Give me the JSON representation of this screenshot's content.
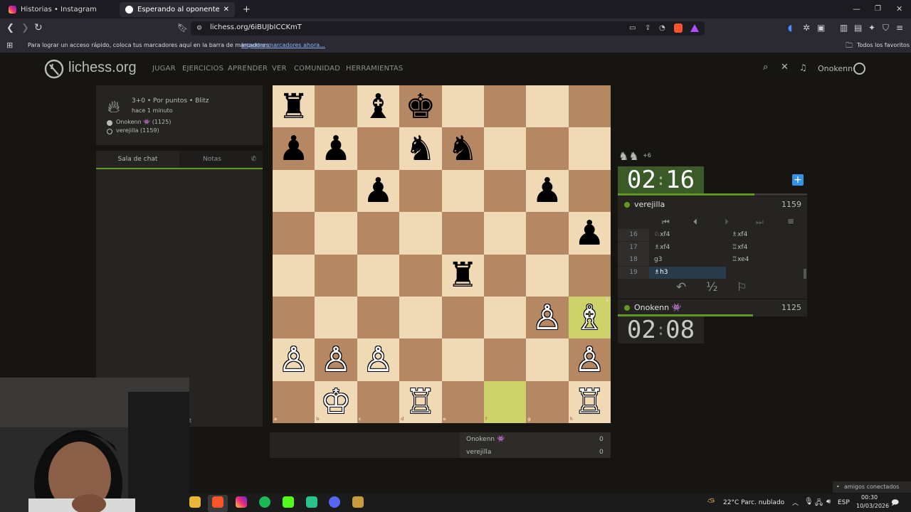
{
  "browser": {
    "tabs": [
      {
        "label": "Historias • Instagram",
        "active": false
      },
      {
        "label": "Esperando al oponente - Jug",
        "active": true
      }
    ],
    "new_tab": "+",
    "url": "lichess.org/6iBUJbICCKmT",
    "bookmarks_hint": "Para lograr un acceso rápido, coloca tus marcadores aquí en la barra de marcadores.",
    "bookmarks_import": "Importar marcadores ahora...",
    "all_favorites": "Todos los favoritos"
  },
  "site": {
    "logo": "lichess.org",
    "nav": [
      "JUGAR",
      "EJERCICIOS",
      "APRENDER",
      "VER",
      "COMUNIDAD",
      "HERRAMIENTAS"
    ],
    "username": "Onokenn"
  },
  "game_info": {
    "mode": "3+0 • Por puntos • Blitz",
    "time_ago": "hace 1 minuto",
    "white": "Onokenn 👾 (1125)",
    "black": "verejilla (1159)"
  },
  "chat": {
    "tab_chat": "Sala de chat",
    "tab_notes": "Notas",
    "partial_text": "t"
  },
  "board": {
    "files": [
      "a",
      "b",
      "c",
      "d",
      "e",
      "f",
      "g",
      "h"
    ],
    "ranks": [
      "8",
      "7",
      "6",
      "5",
      "4",
      "3",
      "2",
      "1"
    ],
    "highlight_squares": [
      "f1",
      "h3"
    ],
    "pieces": [
      {
        "sq": "a8",
        "p": "♜",
        "c": "b"
      },
      {
        "sq": "c8",
        "p": "♝",
        "c": "b"
      },
      {
        "sq": "d8",
        "p": "♚",
        "c": "b"
      },
      {
        "sq": "a7",
        "p": "♟",
        "c": "b"
      },
      {
        "sq": "b7",
        "p": "♟",
        "c": "b"
      },
      {
        "sq": "d7",
        "p": "♞",
        "c": "b"
      },
      {
        "sq": "e7",
        "p": "♞",
        "c": "b"
      },
      {
        "sq": "c6",
        "p": "♟",
        "c": "b"
      },
      {
        "sq": "g6",
        "p": "♟",
        "c": "b"
      },
      {
        "sq": "h5",
        "p": "♟",
        "c": "b"
      },
      {
        "sq": "e4",
        "p": "♜",
        "c": "b"
      },
      {
        "sq": "g3",
        "p": "♙",
        "c": "w"
      },
      {
        "sq": "h3",
        "p": "♗",
        "c": "w"
      },
      {
        "sq": "a2",
        "p": "♙",
        "c": "w"
      },
      {
        "sq": "b2",
        "p": "♙",
        "c": "w"
      },
      {
        "sq": "c2",
        "p": "♙",
        "c": "w"
      },
      {
        "sq": "h2",
        "p": "♙",
        "c": "w"
      },
      {
        "sq": "b1",
        "p": "♔",
        "c": "w"
      },
      {
        "sq": "d1",
        "p": "♖",
        "c": "w"
      },
      {
        "sq": "h1",
        "p": "♖",
        "c": "w"
      }
    ]
  },
  "opponent": {
    "material_diff": "+6",
    "clock_min": "02",
    "clock_sec": "16",
    "clock_sep": ":",
    "name": "verejilla",
    "rating": "1159",
    "time_fraction": 0.72
  },
  "me": {
    "clock_min": "02",
    "clock_sec": "08",
    "clock_sep": ":",
    "name": "Onokenn 👾",
    "rating": "1125",
    "time_fraction": 0.71
  },
  "moves": [
    {
      "n": "16",
      "w": "♘xf4",
      "b": "♗xf4"
    },
    {
      "n": "17",
      "w": "♗xf4",
      "b": "♖xf4"
    },
    {
      "n": "18",
      "w": "g3",
      "b": "♖xe4"
    },
    {
      "n": "19",
      "w": "♗h3",
      "b": ""
    }
  ],
  "move_controls": {
    "first": "⏮",
    "prev": "⏴",
    "next": "⏵",
    "last": "⏭",
    "menu": "≡"
  },
  "actions": {
    "takeback": "↶",
    "draw": "½",
    "resign": "⚐"
  },
  "score": [
    {
      "name": "Onokenn 👾",
      "score": "0"
    },
    {
      "name": "verejilla",
      "score": "0"
    }
  ],
  "taskbar": {
    "weather": "22°C  Parc. nublado",
    "lang": "ESP",
    "time": "00:30",
    "date": "10/03/2026",
    "friends": "amigos conectados"
  },
  "colors": {
    "light_square": "#f0d9b5",
    "dark_square": "#b58863",
    "highlight": "#cdd26a",
    "accent_green": "#629924",
    "online_dot": "#629924"
  }
}
